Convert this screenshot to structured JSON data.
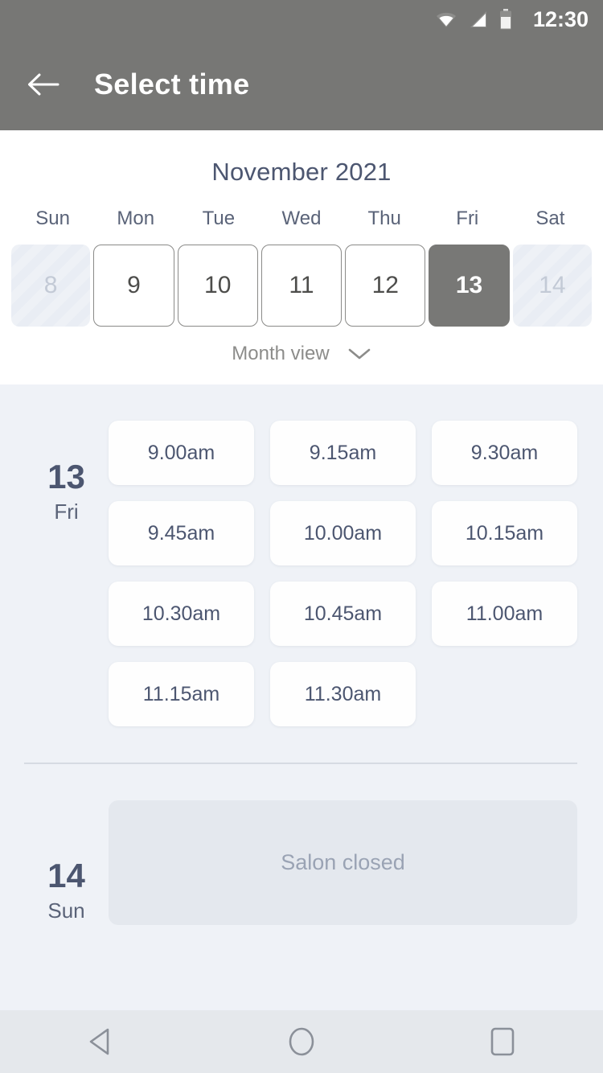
{
  "status_bar": {
    "time": "12:30",
    "icons": [
      "wifi-icon",
      "signal-icon",
      "battery-icon"
    ]
  },
  "app_bar": {
    "back_icon": "arrow-left-icon",
    "title": "Select time",
    "background_color": "#777775"
  },
  "calendar": {
    "month_title": "November 2021",
    "weekdays": [
      "Sun",
      "Mon",
      "Tue",
      "Wed",
      "Thu",
      "Fri",
      "Sat"
    ],
    "days": [
      {
        "number": "8",
        "state": "disabled"
      },
      {
        "number": "9",
        "state": "enabled"
      },
      {
        "number": "10",
        "state": "enabled"
      },
      {
        "number": "11",
        "state": "enabled"
      },
      {
        "number": "12",
        "state": "enabled"
      },
      {
        "number": "13",
        "state": "selected"
      },
      {
        "number": "14",
        "state": "disabled"
      }
    ],
    "view_toggle_label": "Month view",
    "view_toggle_icon": "chevron-down-icon",
    "selected_color": "#787876",
    "title_color": "#4c5670"
  },
  "schedule": {
    "days": [
      {
        "day_number": "13",
        "day_of_week": "Fri",
        "slots": [
          "9.00am",
          "9.15am",
          "9.30am",
          "9.45am",
          "10.00am",
          "10.15am",
          "10.30am",
          "10.45am",
          "11.00am",
          "11.15am",
          "11.30am"
        ]
      },
      {
        "day_number": "14",
        "day_of_week": "Sun",
        "closed_message": "Salon closed"
      }
    ],
    "background_color": "#eff2f7",
    "slot_text_color": "#4c5670"
  },
  "nav_bar": {
    "buttons": [
      "back-triangle-icon",
      "home-circle-icon",
      "recents-square-icon"
    ],
    "background_color": "#e5e8ec",
    "icon_color": "#8b9099"
  }
}
